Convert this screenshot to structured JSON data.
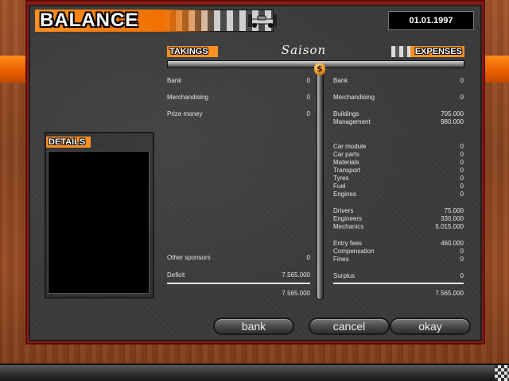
{
  "header": {
    "title": "BALANCE",
    "date": "01.01.1997",
    "car_icon": "race-car-icon"
  },
  "columns": {
    "takings_label": "TAKINGS",
    "season_label": "Saison",
    "expenses_label": "EXPENSES",
    "currency_icon": "dollar-icon"
  },
  "takings": [
    {
      "label": "Bank",
      "value": "0"
    },
    {
      "label": "Merchandising",
      "value": "0"
    },
    {
      "label": "Prize money",
      "value": "0"
    },
    {
      "label": "Other sponsors",
      "value": "0"
    },
    {
      "label": "Deficit",
      "value": "7.565.000"
    }
  ],
  "takings_total": "7.565.000",
  "expenses": [
    {
      "label": "Bank",
      "value": "0"
    },
    {
      "label": "Merchandising",
      "value": "0"
    },
    {
      "label": "Buildings",
      "value": "705.000"
    },
    {
      "label": "Management",
      "value": "980.000"
    },
    {
      "label": "Car module",
      "value": "0"
    },
    {
      "label": "Car parts",
      "value": "0"
    },
    {
      "label": "Materials",
      "value": "0"
    },
    {
      "label": "Transport",
      "value": "0"
    },
    {
      "label": "Tyres",
      "value": "0"
    },
    {
      "label": "Fuel",
      "value": "0"
    },
    {
      "label": "Engines",
      "value": "0"
    },
    {
      "label": "Drivers",
      "value": "75.000"
    },
    {
      "label": "Engineers",
      "value": "330.000"
    },
    {
      "label": "Mechanics",
      "value": "5.015.000"
    },
    {
      "label": "Entry fees",
      "value": "460.000"
    },
    {
      "label": "Compensation",
      "value": "0"
    },
    {
      "label": "Fines",
      "value": "0"
    },
    {
      "label": "Surplus",
      "value": "0"
    }
  ],
  "expenses_total": "7.565.000",
  "details": {
    "label": "DETAILS"
  },
  "buttons": {
    "bank": "bank",
    "cancel": "cancel",
    "okay": "okay"
  },
  "colors": {
    "accent_orange": "#f07000",
    "frame_red": "#8c1a12",
    "panel_dark": "#3a3a3a"
  }
}
